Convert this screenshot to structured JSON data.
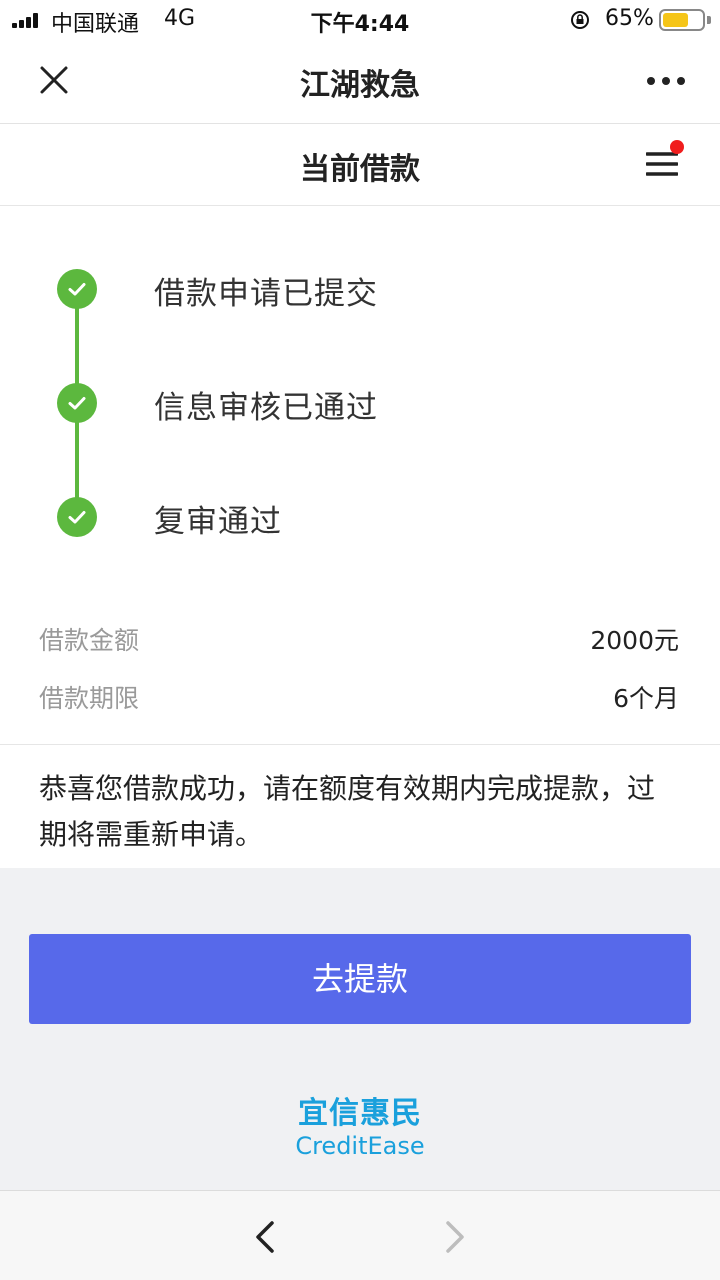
{
  "status_bar": {
    "carrier": "中国联通",
    "network": "4G",
    "time": "下午4:44",
    "battery_percent": "65%",
    "battery_level": 0.65
  },
  "navbar": {
    "title": "江湖救急"
  },
  "page_header": {
    "title": "当前借款",
    "menu_badge_color": "#f01d1d"
  },
  "steps": [
    {
      "label": "借款申请已提交",
      "completed": true
    },
    {
      "label": "信息审核已通过",
      "completed": true
    },
    {
      "label": "复审通过",
      "completed": true
    }
  ],
  "loan_info": [
    {
      "label": "借款金额",
      "value": "2000元"
    },
    {
      "label": "借款期限",
      "value": "6个月"
    }
  ],
  "message": "恭喜您借款成功，请在额度有效期内完成提款，过期将需重新申请。",
  "action": {
    "withdraw_label": "去提款"
  },
  "brand": {
    "name_cn": "宜信惠民",
    "name_en": "CreditEase"
  },
  "colors": {
    "accent_button": "#5769ea",
    "step_green": "#5cb83e",
    "brand_blue": "#1aa0dc"
  }
}
